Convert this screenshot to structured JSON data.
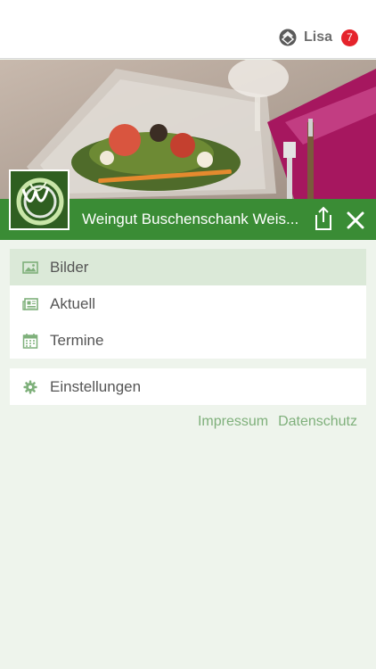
{
  "user": {
    "name": "Lisa",
    "badge_count": "7"
  },
  "venue": {
    "title": "Weingut Buschenschank Weis..."
  },
  "menu_primary": [
    {
      "label": "Bilder",
      "icon": "image-icon",
      "active": true
    },
    {
      "label": "Aktuell",
      "icon": "newspaper-icon",
      "active": false
    },
    {
      "label": "Termine",
      "icon": "calendar-icon",
      "active": false
    }
  ],
  "menu_secondary": [
    {
      "label": "Einstellungen",
      "icon": "gear-icon"
    }
  ],
  "footer": {
    "impressum": "Impressum",
    "datenschutz": "Datenschutz"
  },
  "colors": {
    "brand_green": "#3a8c35",
    "active_row": "#dbe9d8",
    "badge_red": "#e5232b",
    "link_green": "#7fb07b"
  }
}
